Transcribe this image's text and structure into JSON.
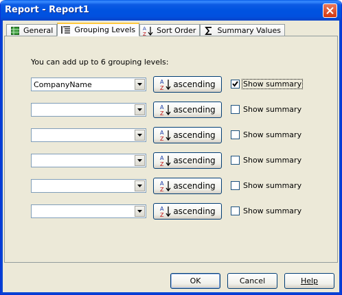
{
  "window": {
    "title": "Report - Report1"
  },
  "tabs": [
    {
      "label": "General",
      "icon": "table-icon"
    },
    {
      "label": "Grouping Levels",
      "icon": "grouping-icon"
    },
    {
      "label": "Sort Order",
      "icon": "sort-az-icon"
    },
    {
      "label": "Summary Values",
      "icon": "sigma-icon"
    }
  ],
  "grouping": {
    "intro": "You can add up to 6 grouping levels:",
    "levels": [
      {
        "field": "CompanyName",
        "sort_label": "ascending",
        "summary_label": "Show summary",
        "summary_checked": true
      },
      {
        "field": "",
        "sort_label": "ascending",
        "summary_label": "Show summary",
        "summary_checked": false
      },
      {
        "field": "",
        "sort_label": "ascending",
        "summary_label": "Show summary",
        "summary_checked": false
      },
      {
        "field": "",
        "sort_label": "ascending",
        "summary_label": "Show summary",
        "summary_checked": false
      },
      {
        "field": "",
        "sort_label": "ascending",
        "summary_label": "Show summary",
        "summary_checked": false
      },
      {
        "field": "",
        "sort_label": "ascending",
        "summary_label": "Show summary",
        "summary_checked": false
      }
    ]
  },
  "footer": {
    "ok_label": "OK",
    "cancel_label": "Cancel",
    "help_label": "Help"
  }
}
